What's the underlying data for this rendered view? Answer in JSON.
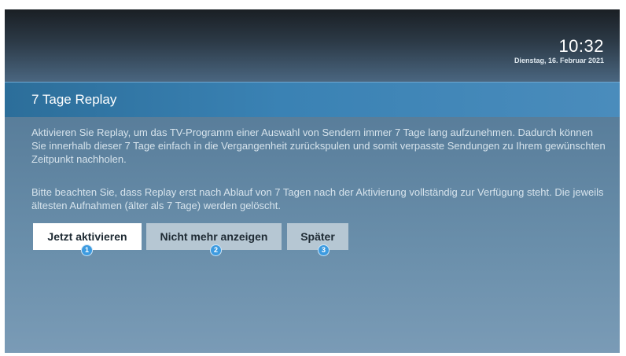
{
  "header": {
    "time": "10:32",
    "date": "Dienstag, 16. Februar 2021"
  },
  "dialog": {
    "title": "7 Tage Replay",
    "paragraph1": "Aktivieren Sie Replay, um das TV-Programm einer Auswahl von Sendern immer 7 Tage lang aufzunehmen. Dadurch können Sie innerhalb dieser 7 Tage einfach in die Vergangenheit zurückspulen und somit verpasste Sendungen zu Ihrem gewünschten Zeitpunkt nachholen.",
    "paragraph2": "Bitte beachten Sie, dass Replay erst nach Ablauf von 7 Tagen nach der Aktivierung vollständig zur Verfügung steht. Die jeweils ältesten Aufnahmen (älter als 7 Tage) werden gelöscht."
  },
  "buttons": [
    {
      "label": "Jetzt aktivieren",
      "badge": "1"
    },
    {
      "label": "Nicht mehr anzeigen",
      "badge": "2"
    },
    {
      "label": "Später",
      "badge": "3"
    }
  ],
  "colors": {
    "title_bar": "#3a82b4",
    "badge": "#3d9be0",
    "focused_button": "#ffffff",
    "secondary_button": "#b6c7d3"
  }
}
